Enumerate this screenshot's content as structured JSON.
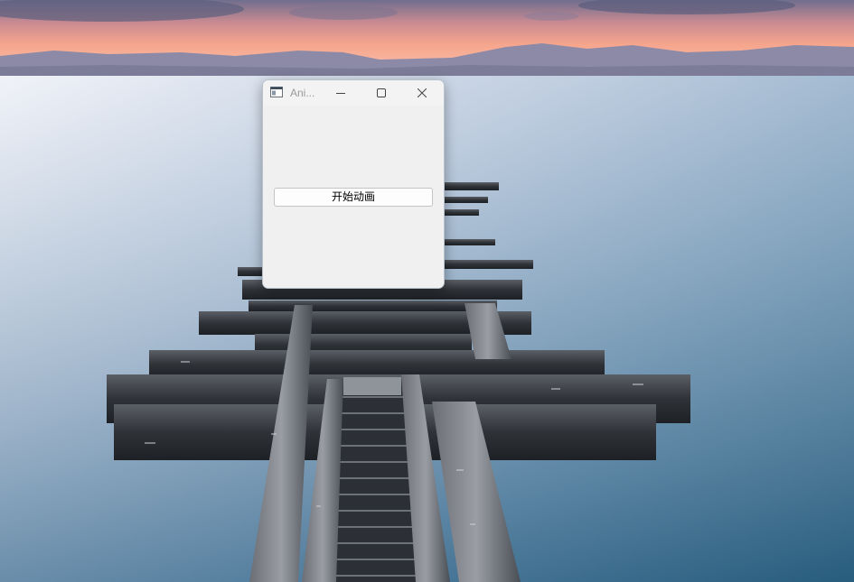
{
  "window": {
    "title": "Ani...",
    "icon": "app-window-icon",
    "caption_buttons": [
      "minimize-icon",
      "maximize-icon",
      "close-icon"
    ]
  },
  "main": {
    "start_button_label": "开始动画"
  },
  "wallpaper": {
    "description_colors": {
      "sky": "#f2a38c",
      "mountains": "#8c8aa8",
      "water_top": "#dfe4ef",
      "water_bottom": "#3c6f8f",
      "pier": "#3a3f47"
    }
  }
}
